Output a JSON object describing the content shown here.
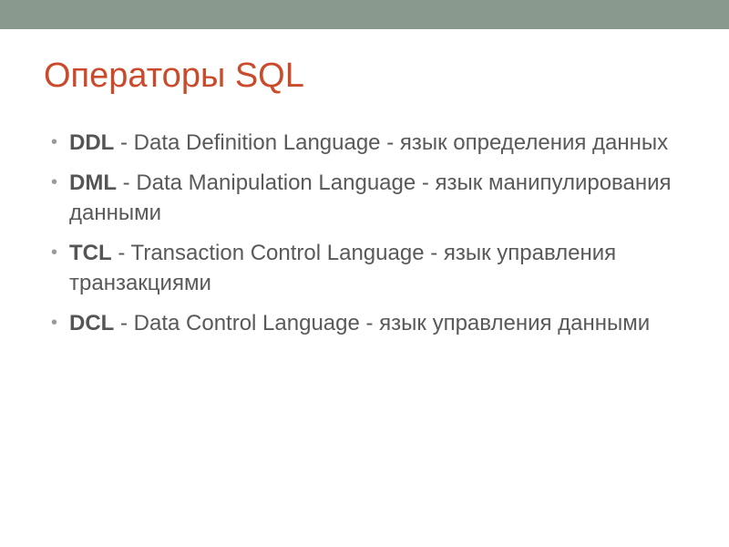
{
  "title": "Операторы SQL",
  "items": [
    {
      "term": "DDL",
      "desc": " - Data Definition Language - язык определения данных"
    },
    {
      "term": "DML",
      "desc": " - Data Manipulation Language - язык манипулирования данными"
    },
    {
      "term": "TCL",
      "desc": " - Transaction Control Language - язык управления транзакциями"
    },
    {
      "term": "DCL",
      "desc": "  - Data Control Language - язык управления данными"
    }
  ]
}
